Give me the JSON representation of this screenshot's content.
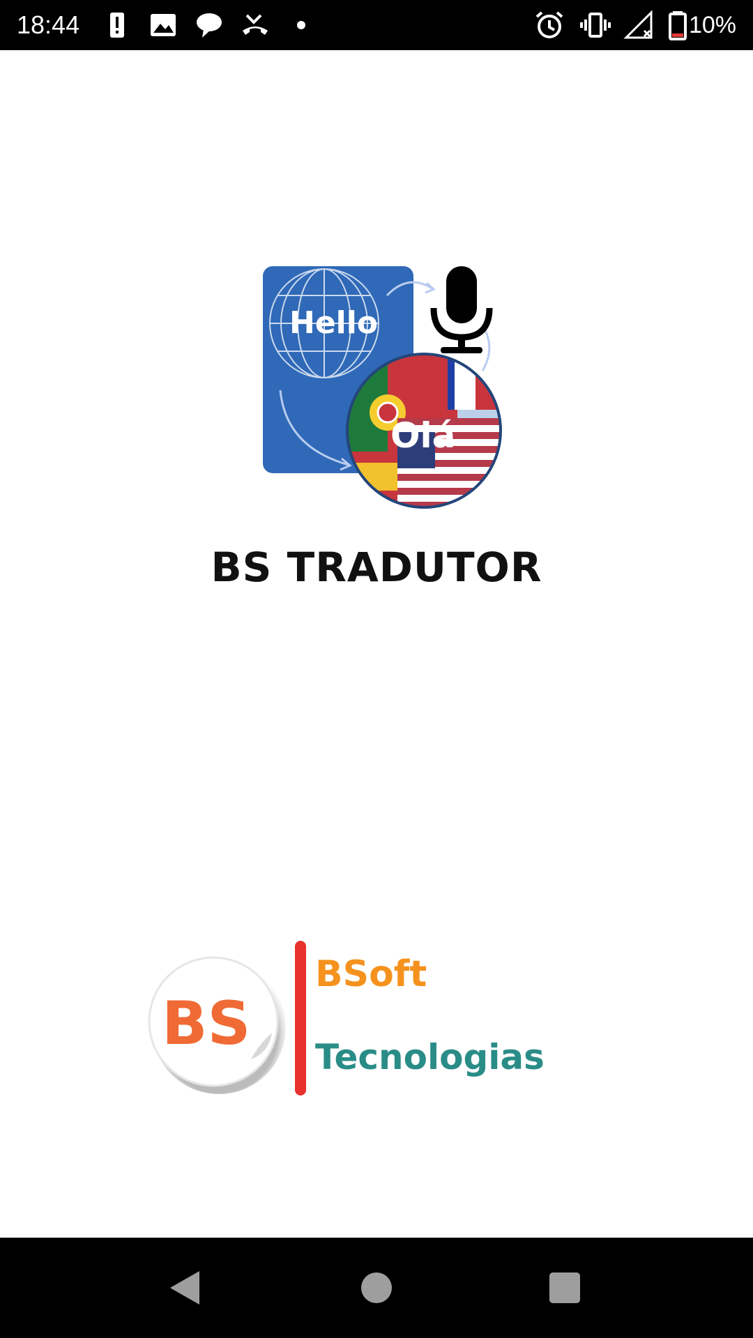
{
  "status_bar": {
    "time": "18:44",
    "battery_percent": "10%",
    "icons_left": [
      "alert-icon",
      "image-icon",
      "chat-icon",
      "missed-call-icon",
      "dot-icon"
    ],
    "icons_right": [
      "alarm-icon",
      "vibrate-icon",
      "signal-icon",
      "battery-icon"
    ]
  },
  "logo": {
    "word_source": "Hello",
    "word_target": "Olá"
  },
  "app": {
    "title": "BS TRADUTOR"
  },
  "company": {
    "badge_letters": "BS",
    "name_line1": "BSoft",
    "name_line2": "Tecnologias"
  },
  "nav": {
    "icons": [
      "back-icon",
      "home-icon",
      "recents-icon"
    ]
  },
  "colors": {
    "logo_blue": "#2f69b8",
    "brand_orange": "#f5921e",
    "brand_teal": "#2a8c87",
    "divider_red": "#e8302c"
  }
}
